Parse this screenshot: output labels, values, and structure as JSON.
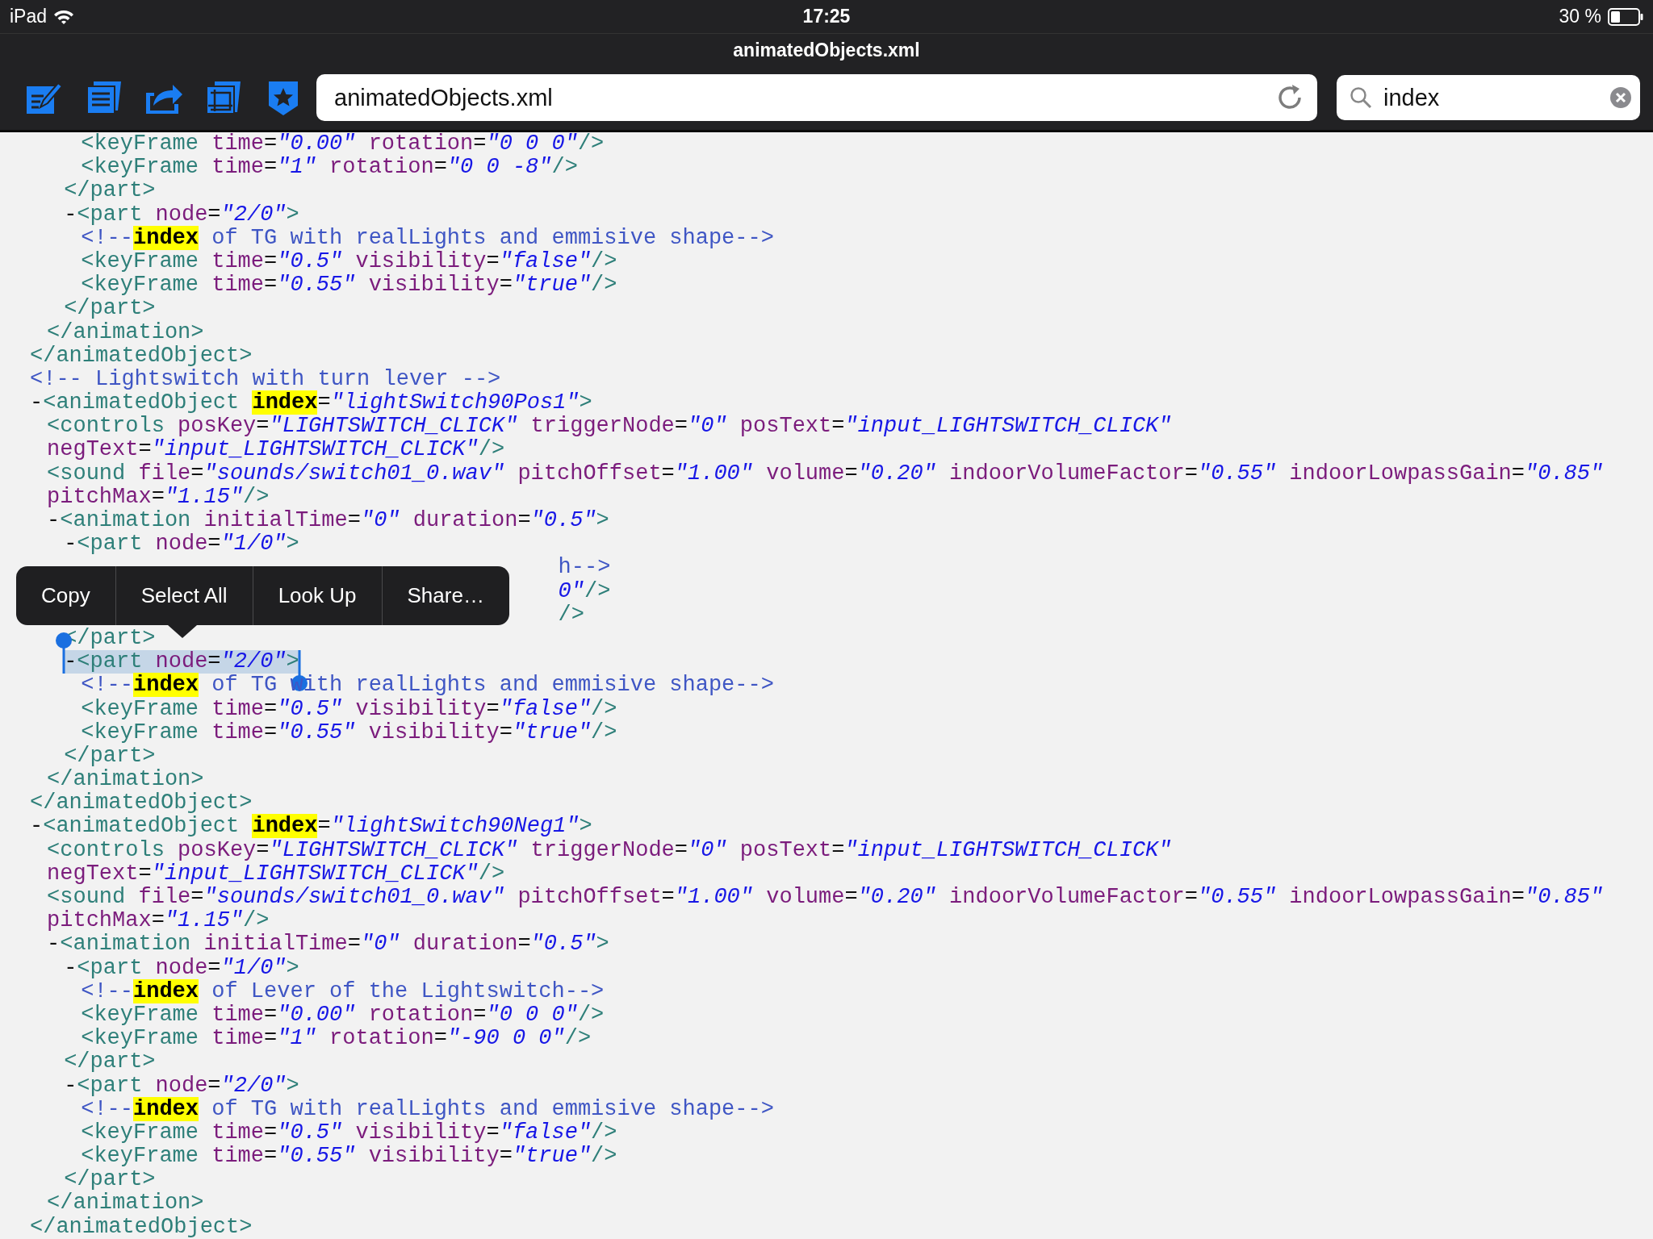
{
  "status_bar": {
    "device": "iPad",
    "time": "17:25",
    "battery": "30 %"
  },
  "title": "animatedObjects.xml",
  "address_field": {
    "value": "animatedObjects.xml"
  },
  "search_field": {
    "value": "index"
  },
  "lines": [
    {
      "text": "   <keyFrame time=\"0.00\" rotation=\"0 0 0\"/>",
      "selected": false
    },
    {
      "text": "   <keyFrame time=\"1\" rotation=\"0 0 -8\"/>",
      "selected": false
    },
    {
      "text": "  </part>",
      "selected": false
    },
    {
      "text": "  -<part node=\"2/0\">",
      "selected": false
    },
    {
      "text": "   <!--**index** of TG with realLights and emmisive shape-->",
      "selected": false
    },
    {
      "text": "   <keyFrame time=\"0.5\" visibility=\"false\"/>",
      "selected": false
    },
    {
      "text": "   <keyFrame time=\"0.55\" visibility=\"true\"/>",
      "selected": false
    },
    {
      "text": "  </part>",
      "selected": false
    },
    {
      "text": " </animation>",
      "selected": false
    },
    {
      "text": "</animatedObject>",
      "selected": false
    },
    {
      "text": "<!-- Lightswitch with turn lever -->",
      "selected": false
    },
    {
      "text": "-<animatedObject **index**=\"lightSwitch90Pos1\">",
      "selected": false
    },
    {
      "text": " <controls posKey=\"LIGHTSWITCH_CLICK\" triggerNode=\"0\" posText=\"input_LIGHTSWITCH_CLICK\"",
      "selected": false
    },
    {
      "text": " negText=\"input_LIGHTSWITCH_CLICK\"/>",
      "selected": false
    },
    {
      "text": " <sound file=\"sounds/switch01_0.wav\" pitchOffset=\"1.00\" volume=\"0.20\" indoorVolumeFactor=\"0.55\" indoorLowpassGain=\"0.85\"",
      "selected": false
    },
    {
      "text": " pitchMax=\"1.15\"/>",
      "selected": false
    },
    {
      "text": " -<animation initialTime=\"0\" duration=\"0.5\">",
      "selected": false
    },
    {
      "text": "  -<part node=\"1/0\">",
      "selected": false
    },
    {
      "text": "h-->",
      "selected": false,
      "covered": true
    },
    {
      "text": "0\"/>",
      "selected": false,
      "covered": true
    },
    {
      "text": "/>",
      "selected": false,
      "covered": true
    },
    {
      "text": "  </part>",
      "selected": false
    },
    {
      "text": "  -<part node=\"2/0\">",
      "selected": true
    },
    {
      "text": "   <!--**index** of TG with realLights and emmisive shape-->",
      "selected": false
    },
    {
      "text": "   <keyFrame time=\"0.5\" visibility=\"false\"/>",
      "selected": false
    },
    {
      "text": "   <keyFrame time=\"0.55\" visibility=\"true\"/>",
      "selected": false
    },
    {
      "text": "  </part>",
      "selected": false
    },
    {
      "text": " </animation>",
      "selected": false
    },
    {
      "text": "</animatedObject>",
      "selected": false
    },
    {
      "text": "-<animatedObject **index**=\"lightSwitch90Neg1\">",
      "selected": false
    },
    {
      "text": " <controls posKey=\"LIGHTSWITCH_CLICK\" triggerNode=\"0\" posText=\"input_LIGHTSWITCH_CLICK\"",
      "selected": false
    },
    {
      "text": " negText=\"input_LIGHTSWITCH_CLICK\"/>",
      "selected": false
    },
    {
      "text": " <sound file=\"sounds/switch01_0.wav\" pitchOffset=\"1.00\" volume=\"0.20\" indoorVolumeFactor=\"0.55\" indoorLowpassGain=\"0.85\"",
      "selected": false
    },
    {
      "text": " pitchMax=\"1.15\"/>",
      "selected": false
    },
    {
      "text": " -<animation initialTime=\"0\" duration=\"0.5\">",
      "selected": false
    },
    {
      "text": "  -<part node=\"1/0\">",
      "selected": false
    },
    {
      "text": "   <!--**index** of Lever of the Lightswitch-->",
      "selected": false
    },
    {
      "text": "   <keyFrame time=\"0.00\" rotation=\"0 0 0\"/>",
      "selected": false
    },
    {
      "text": "   <keyFrame time=\"1\" rotation=\"-90 0 0\"/>",
      "selected": false
    },
    {
      "text": "  </part>",
      "selected": false
    },
    {
      "text": "  -<part node=\"2/0\">",
      "selected": false
    },
    {
      "text": "   <!--**index** of TG with realLights and emmisive shape-->",
      "selected": false
    },
    {
      "text": "   <keyFrame time=\"0.5\" visibility=\"false\"/>",
      "selected": false
    },
    {
      "text": "   <keyFrame time=\"0.55\" visibility=\"true\"/>",
      "selected": false
    },
    {
      "text": "  </part>",
      "selected": false
    },
    {
      "text": " </animation>",
      "selected": false
    },
    {
      "text": "</animatedObject>",
      "selected": false
    }
  ],
  "context_menu": {
    "items": [
      "Copy",
      "Select All",
      "Look Up",
      "Share…"
    ]
  }
}
